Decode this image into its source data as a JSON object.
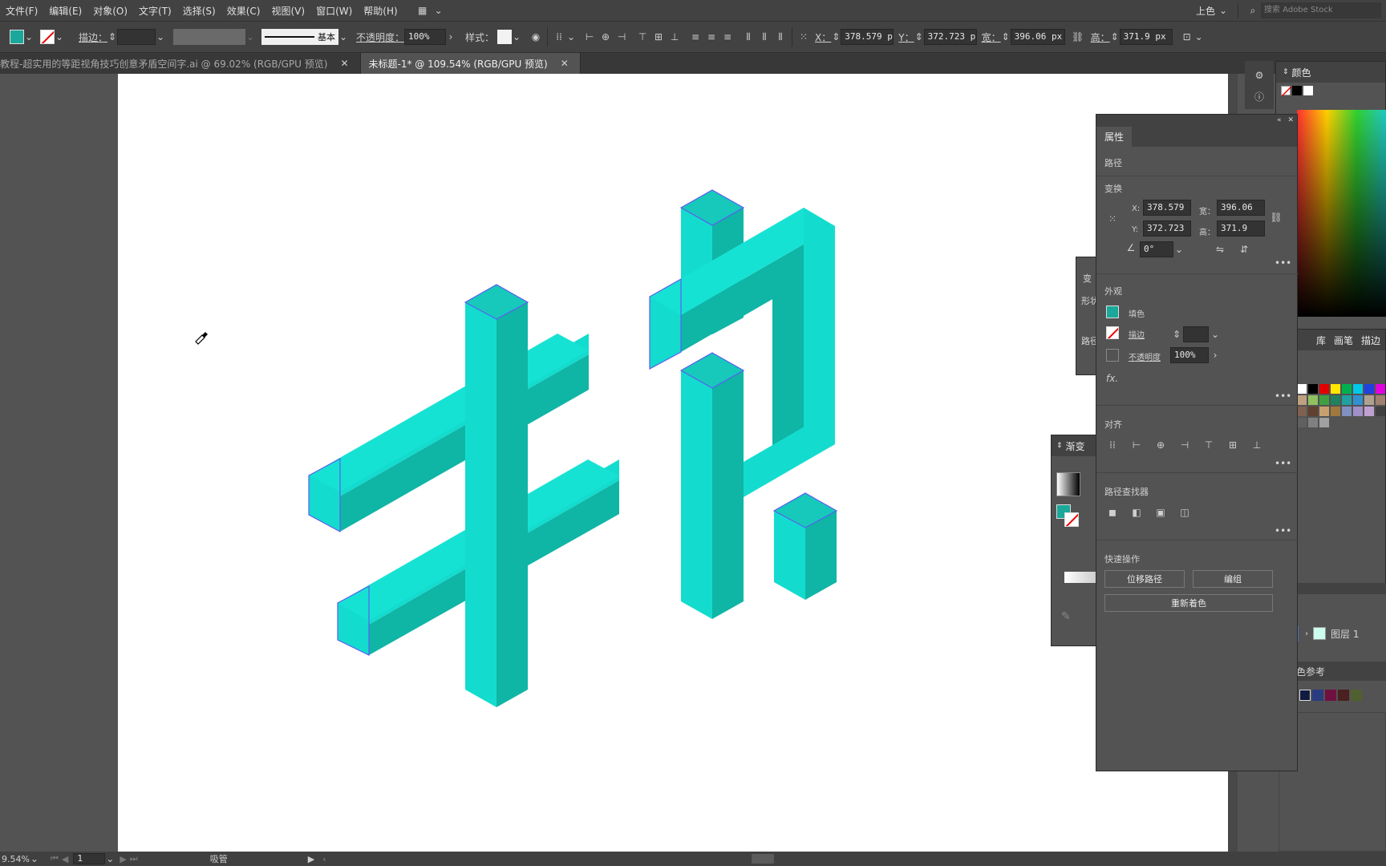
{
  "menus": [
    "文件(F)",
    "编辑(E)",
    "对象(O)",
    "文字(T)",
    "选择(S)",
    "效果(C)",
    "视图(V)",
    "窗口(W)",
    "帮助(H)"
  ],
  "workspace": "上色",
  "search_placeholder": "搜索 Adobe Stock",
  "control": {
    "stroke_label": "描边：",
    "stroke_style": "基本",
    "opacity_label": "不透明度：",
    "opacity_value": "100%",
    "style_label": "样式：",
    "x_label": "X：",
    "x_value": "378.579 p",
    "y_label": "Y：",
    "y_value": "372.723 p",
    "w_label": "宽：",
    "w_value": "396.06 px",
    "h_label": "高：",
    "h_value": "371.9 px"
  },
  "tabs": [
    {
      "label": "教程-超实用的等距视角技巧创意矛盾空间字.ai @ 69.02% (RGB/GPU 预览)"
    },
    {
      "label": "未标题-1* @ 109.54% (RGB/GPU 预览)"
    }
  ],
  "status": {
    "zoom": "9.54%",
    "page": "1",
    "tool": "吸管"
  },
  "color_panel": {
    "title": "颜色"
  },
  "swatch_tabs": [
    "库",
    "画笔",
    "描边"
  ],
  "layers": {
    "item": "图层 1"
  },
  "color_guide": {
    "title": "色参考"
  },
  "gradient_panel": {
    "title": "渐变"
  },
  "side_panel": {
    "labels": [
      "变",
      "形状",
      "路径"
    ]
  },
  "properties": {
    "title": "属性",
    "object_type": "路径",
    "transform_label": "变换",
    "x_label": "X:",
    "x": "378.579",
    "y_label": "Y:",
    "y": "372.723",
    "w_label": "宽：",
    "w": "396.06 p",
    "h_label": "高：",
    "h": "371.9 px",
    "angle": "0°",
    "appearance_label": "外观",
    "fill_label": "填色",
    "stroke_label": "描边",
    "opacity_label": "不透明度",
    "opacity": "100%",
    "fx": "fx.",
    "align_label": "对齐",
    "pathfinder_label": "路径查找器",
    "quick_actions_label": "快速操作",
    "offset_path": "位移路径",
    "group": "编组",
    "recolor": "重新着色"
  },
  "colors": {
    "fill": "#1aa89a",
    "teal_front": "#13dccf",
    "teal_side": "#0fb5a5",
    "teal_top": "#16c9bb",
    "anchor": "#5a5ff0"
  }
}
